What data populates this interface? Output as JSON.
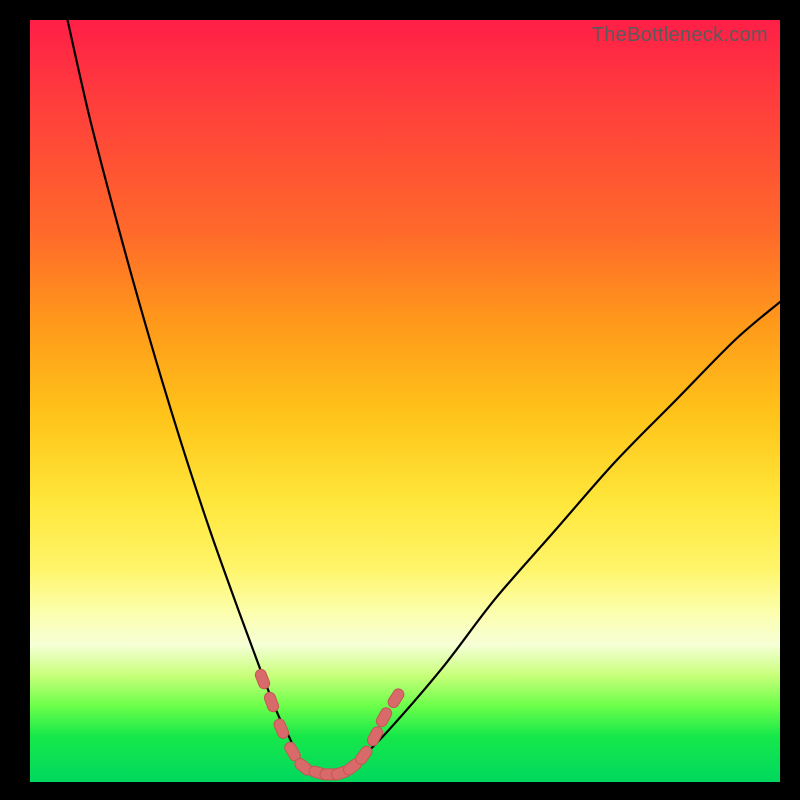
{
  "watermark": "TheBottleneck.com",
  "colors": {
    "frame": "#000000",
    "curve": "#000000",
    "marker_fill": "#d86a6a",
    "marker_stroke": "#c45656",
    "gradient": [
      "#ff1f47",
      "#ff6a2a",
      "#ffe63a",
      "#fcffb0",
      "#00d85e"
    ]
  },
  "chart_data": {
    "type": "line",
    "title": "",
    "xlabel": "",
    "ylabel": "",
    "xlim": [
      0,
      100
    ],
    "ylim": [
      0,
      100
    ],
    "curve": {
      "x": [
        5,
        8,
        12,
        16,
        20,
        24,
        28,
        31,
        33,
        34.5,
        36,
        38,
        40,
        42,
        44,
        48,
        55,
        62,
        70,
        78,
        86,
        94,
        100
      ],
      "y": [
        100,
        87,
        72,
        58,
        45,
        33,
        22,
        14,
        9,
        6,
        3,
        1.5,
        1,
        1.5,
        3,
        7,
        15,
        24,
        33,
        42,
        50,
        58,
        63
      ]
    },
    "markers": [
      {
        "x": 31.0,
        "y": 13.5
      },
      {
        "x": 32.2,
        "y": 10.5
      },
      {
        "x": 33.5,
        "y": 7.0
      },
      {
        "x": 35.0,
        "y": 4.0
      },
      {
        "x": 36.5,
        "y": 2.0
      },
      {
        "x": 38.5,
        "y": 1.2
      },
      {
        "x": 40.0,
        "y": 1.0
      },
      {
        "x": 41.5,
        "y": 1.2
      },
      {
        "x": 43.0,
        "y": 2.0
      },
      {
        "x": 44.5,
        "y": 3.5
      },
      {
        "x": 46.0,
        "y": 6.0
      },
      {
        "x": 47.2,
        "y": 8.5
      },
      {
        "x": 48.8,
        "y": 11.0
      }
    ],
    "annotations": []
  }
}
